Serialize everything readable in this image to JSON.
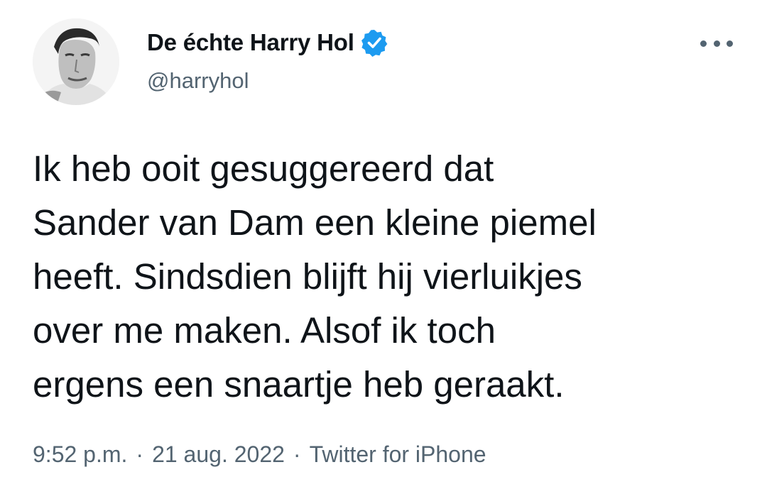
{
  "author": {
    "display_name": "De échte Harry Hol",
    "handle": "@harryhol",
    "verified": true,
    "avatar_icon": "avatar-photo"
  },
  "tweet": {
    "text": "Ik heb ooit gesuggereerd dat\nSander van Dam een kleine piemel\nheeft. Sindsdien blijft hij vierluikjes\nover me maken. Alsof ik toch\nergens een snaartje heb geraakt."
  },
  "meta": {
    "time": "9:52 p.m.",
    "separator": "·",
    "date": "21 aug. 2022",
    "source": "Twitter for iPhone"
  },
  "icons": {
    "more": "more-options-icon",
    "verified": "verified-badge-icon"
  },
  "colors": {
    "text_primary": "#0f1419",
    "text_secondary": "#536471",
    "verified_blue": "#1d9bf0",
    "background": "#ffffff"
  }
}
